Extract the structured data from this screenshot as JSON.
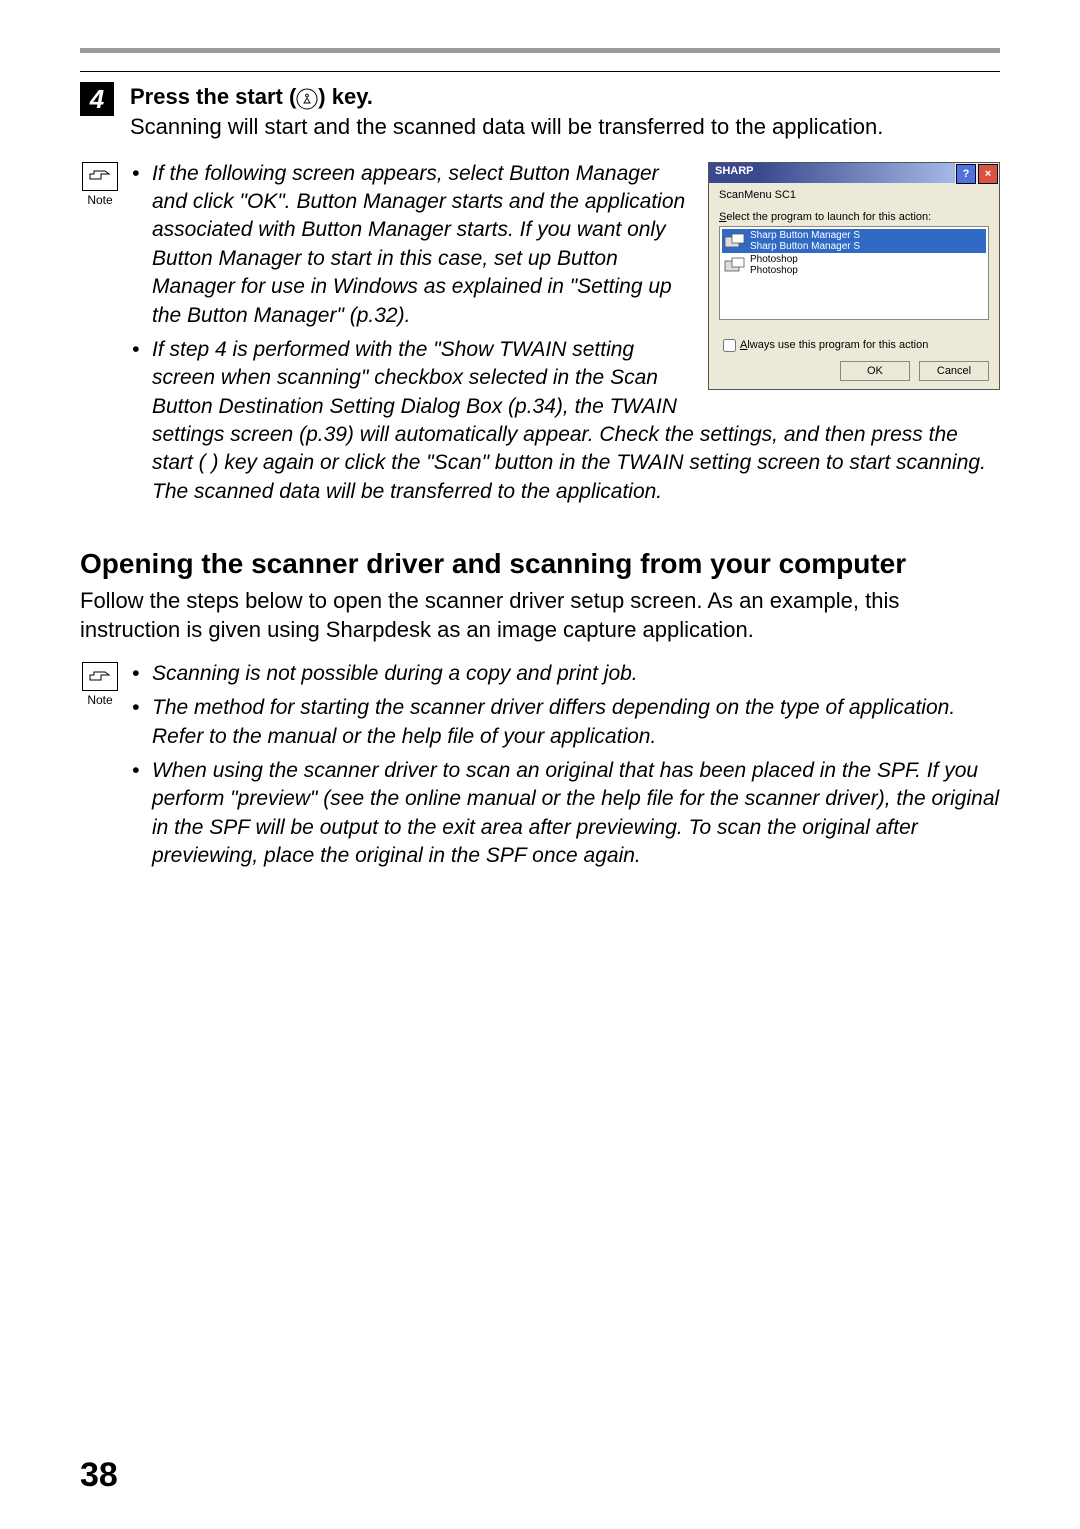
{
  "step": {
    "number": "4",
    "title_pre": "Press the start (",
    "title_post": ") key.",
    "description": "Scanning will start and the scanned data will be transferred to the application."
  },
  "note1": {
    "label": "Note",
    "bullets": [
      "If the following screen appears, select Button Manager and click \"OK\". Button Manager starts and the application associated with Button Manager starts. If you want only Button Manager to start in this case, set up Button Manager for use in Windows as explained in \"Setting up the Button Manager\" (p.32).",
      "If step 4 is performed with the \"Show TWAIN setting screen when scanning\" checkbox selected in the Scan Button Destination Setting Dialog Box (p.34), the TWAIN settings screen (p.39) will automatically appear. Check the settings, and then press the start (      ) key again or click the \"Scan\" button in the TWAIN setting screen to start scanning. The scanned data will be transferred to the application."
    ]
  },
  "dialog": {
    "brand": "SHARP",
    "subtitle": "ScanMenu SC1",
    "select_label": "Select the program to launch for this action:",
    "items": [
      {
        "line1": "Sharp Button Manager S",
        "line2": "Sharp Button Manager S",
        "selected": true
      },
      {
        "line1": "Photoshop",
        "line2": "Photoshop",
        "selected": false
      }
    ],
    "checkbox_label": "Always use this program for this action",
    "ok": "OK",
    "cancel": "Cancel"
  },
  "section": {
    "title": "Opening the scanner driver and scanning from your computer",
    "desc": "Follow the steps below to open the scanner driver setup screen. As an example, this instruction is given using Sharpdesk as an image capture application."
  },
  "note2": {
    "label": "Note",
    "bullets": [
      "Scanning is not possible during a copy and print job.",
      "The method for starting the scanner driver differs depending on the type of application. Refer to the manual or the help file of your application.",
      "When using the scanner driver to scan an original that has been placed in the SPF. If you perform \"preview\" (see the online manual or the help file for the scanner driver), the original in the SPF will be output to the exit area after previewing. To scan the original after previewing, place the original in the SPF once again."
    ]
  },
  "page_number": "38"
}
